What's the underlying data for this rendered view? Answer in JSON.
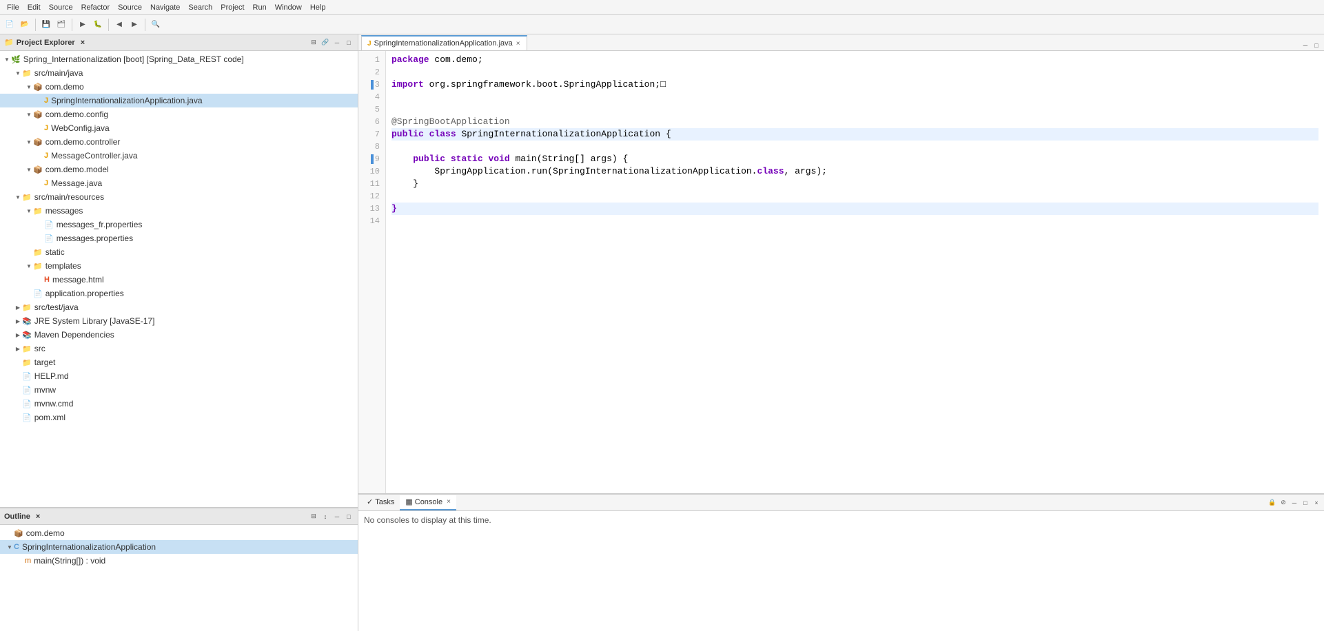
{
  "menubar": {
    "items": [
      "File",
      "Edit",
      "Source",
      "Refactor",
      "Source",
      "Navigate",
      "Search",
      "Project",
      "Run",
      "Window",
      "Help"
    ]
  },
  "project_explorer": {
    "title": "Project Explorer",
    "close_label": "×",
    "tree": [
      {
        "id": "spring-root",
        "label": "Spring_Internationalization [boot] [Spring_Data_REST code]",
        "indent": 0,
        "type": "project",
        "expanded": true,
        "arrow": "▼"
      },
      {
        "id": "src-main-java",
        "label": "src/main/java",
        "indent": 1,
        "type": "folder",
        "expanded": true,
        "arrow": "▼"
      },
      {
        "id": "com-demo",
        "label": "com.demo",
        "indent": 2,
        "type": "package",
        "expanded": true,
        "arrow": "▼"
      },
      {
        "id": "spring-app",
        "label": "SpringInternationalizationApplication.java",
        "indent": 3,
        "type": "java",
        "expanded": false,
        "arrow": ""
      },
      {
        "id": "com-demo-config",
        "label": "com.demo.config",
        "indent": 2,
        "type": "package",
        "expanded": true,
        "arrow": "▼"
      },
      {
        "id": "webconfig",
        "label": "WebConfig.java",
        "indent": 3,
        "type": "java",
        "expanded": false,
        "arrow": ""
      },
      {
        "id": "com-demo-controller",
        "label": "com.demo.controller",
        "indent": 2,
        "type": "package",
        "expanded": true,
        "arrow": "▼"
      },
      {
        "id": "msgcontroller",
        "label": "MessageController.java",
        "indent": 3,
        "type": "java",
        "expanded": false,
        "arrow": ""
      },
      {
        "id": "com-demo-model",
        "label": "com.demo.model",
        "indent": 2,
        "type": "package",
        "expanded": true,
        "arrow": "▼"
      },
      {
        "id": "message",
        "label": "Message.java",
        "indent": 3,
        "type": "java",
        "expanded": false,
        "arrow": ""
      },
      {
        "id": "src-main-resources",
        "label": "src/main/resources",
        "indent": 1,
        "type": "folder",
        "expanded": true,
        "arrow": "▼"
      },
      {
        "id": "messages-folder",
        "label": "messages",
        "indent": 2,
        "type": "folder",
        "expanded": true,
        "arrow": "▼"
      },
      {
        "id": "msg-fr",
        "label": "messages_fr.properties",
        "indent": 3,
        "type": "properties",
        "expanded": false,
        "arrow": ""
      },
      {
        "id": "msg-props",
        "label": "messages.properties",
        "indent": 3,
        "type": "properties",
        "expanded": false,
        "arrow": ""
      },
      {
        "id": "static",
        "label": "static",
        "indent": 2,
        "type": "folder",
        "expanded": false,
        "arrow": ""
      },
      {
        "id": "templates-folder",
        "label": "templates",
        "indent": 2,
        "type": "folder",
        "expanded": true,
        "arrow": "▼"
      },
      {
        "id": "message-html",
        "label": "message.html",
        "indent": 3,
        "type": "html",
        "expanded": false,
        "arrow": ""
      },
      {
        "id": "app-props",
        "label": "application.properties",
        "indent": 2,
        "type": "properties",
        "expanded": false,
        "arrow": ""
      },
      {
        "id": "src-test-java",
        "label": "src/test/java",
        "indent": 1,
        "type": "folder",
        "expanded": false,
        "arrow": "▶"
      },
      {
        "id": "jre-lib",
        "label": "JRE System Library [JavaSE-17]",
        "indent": 1,
        "type": "library",
        "expanded": false,
        "arrow": "▶"
      },
      {
        "id": "maven-deps",
        "label": "Maven Dependencies",
        "indent": 1,
        "type": "library",
        "expanded": false,
        "arrow": "▶"
      },
      {
        "id": "src",
        "label": "src",
        "indent": 1,
        "type": "folder",
        "expanded": false,
        "arrow": "▶"
      },
      {
        "id": "target",
        "label": "target",
        "indent": 1,
        "type": "folder",
        "expanded": false,
        "arrow": ""
      },
      {
        "id": "help-md",
        "label": "HELP.md",
        "indent": 1,
        "type": "file",
        "expanded": false,
        "arrow": ""
      },
      {
        "id": "mvnw",
        "label": "mvnw",
        "indent": 1,
        "type": "file",
        "expanded": false,
        "arrow": ""
      },
      {
        "id": "mvnw-cmd",
        "label": "mvnw.cmd",
        "indent": 1,
        "type": "file",
        "expanded": false,
        "arrow": ""
      },
      {
        "id": "pom",
        "label": "pom.xml",
        "indent": 1,
        "type": "file",
        "expanded": false,
        "arrow": ""
      }
    ]
  },
  "editor": {
    "tab_title": "SpringInternationalizationApplication.java",
    "lines": [
      {
        "num": 1,
        "text": "package com.demo;",
        "tokens": [
          {
            "t": "package",
            "cls": "kw-package"
          },
          {
            "t": " com.demo;",
            "cls": ""
          }
        ]
      },
      {
        "num": 2,
        "text": "",
        "tokens": []
      },
      {
        "num": 3,
        "text": "import org.springframework.boot.SpringApplication;□",
        "tokens": [
          {
            "t": "import",
            "cls": "kw-import"
          },
          {
            "t": " org.springframework.boot.SpringApplication;□",
            "cls": ""
          }
        ],
        "marker": true
      },
      {
        "num": 4,
        "text": "",
        "tokens": []
      },
      {
        "num": 5,
        "text": "",
        "tokens": []
      },
      {
        "num": 6,
        "text": "@SpringBootApplication",
        "tokens": [
          {
            "t": "@SpringBootApplication",
            "cls": "annotation"
          }
        ]
      },
      {
        "num": 7,
        "text": "public class SpringInternationalizationApplication {",
        "tokens": [
          {
            "t": "public",
            "cls": "kw-public"
          },
          {
            "t": " ",
            "cls": ""
          },
          {
            "t": "class",
            "cls": "kw-class"
          },
          {
            "t": " SpringInternationalizationApplication {",
            "cls": ""
          }
        ],
        "highlighted": true
      },
      {
        "num": 8,
        "text": "",
        "tokens": []
      },
      {
        "num": 9,
        "text": "    public static void main(String[] args) {",
        "tokens": [
          {
            "t": "    ",
            "cls": ""
          },
          {
            "t": "public",
            "cls": "kw-public"
          },
          {
            "t": " ",
            "cls": ""
          },
          {
            "t": "static",
            "cls": "kw-static"
          },
          {
            "t": " ",
            "cls": ""
          },
          {
            "t": "void",
            "cls": "kw-void"
          },
          {
            "t": " main(String[] args) {",
            "cls": ""
          }
        ],
        "marker": true
      },
      {
        "num": 10,
        "text": "        SpringApplication.run(SpringInternationalizationApplication.class, args);",
        "tokens": [
          {
            "t": "        SpringApplication.run(SpringInternationalizationApplication.",
            "cls": ""
          },
          {
            "t": "class",
            "cls": "kw-class"
          },
          {
            "t": ", args);",
            "cls": ""
          }
        ]
      },
      {
        "num": 11,
        "text": "    }",
        "tokens": [
          {
            "t": "    }",
            "cls": ""
          }
        ]
      },
      {
        "num": 12,
        "text": "",
        "tokens": []
      },
      {
        "num": 13,
        "text": "}",
        "tokens": [
          {
            "t": "}",
            "cls": "kw-package"
          }
        ],
        "highlighted": true
      },
      {
        "num": 14,
        "text": "",
        "tokens": []
      }
    ]
  },
  "bottom_panel": {
    "tabs": [
      "Tasks",
      "Console"
    ],
    "active_tab": "Console",
    "content": "No consoles to display at this time."
  },
  "outline_panel": {
    "title": "Outline",
    "tree": [
      {
        "id": "outline-com-demo",
        "label": "com.demo",
        "indent": 0,
        "type": "package",
        "arrow": ""
      },
      {
        "id": "outline-class",
        "label": "SpringInternationalizationApplication",
        "indent": 0,
        "type": "class",
        "arrow": "▼",
        "selected": true
      },
      {
        "id": "outline-main",
        "label": "main(String[]) : void",
        "indent": 1,
        "type": "method",
        "arrow": ""
      }
    ]
  },
  "icons": {
    "folder": "📁",
    "java": "J",
    "properties": "📄",
    "html": "🌐",
    "package": "📦",
    "library": "📚",
    "file": "📄",
    "class": "C",
    "method": "m",
    "close": "×",
    "minimize": "─",
    "maximize": "□",
    "restore": "❐"
  }
}
